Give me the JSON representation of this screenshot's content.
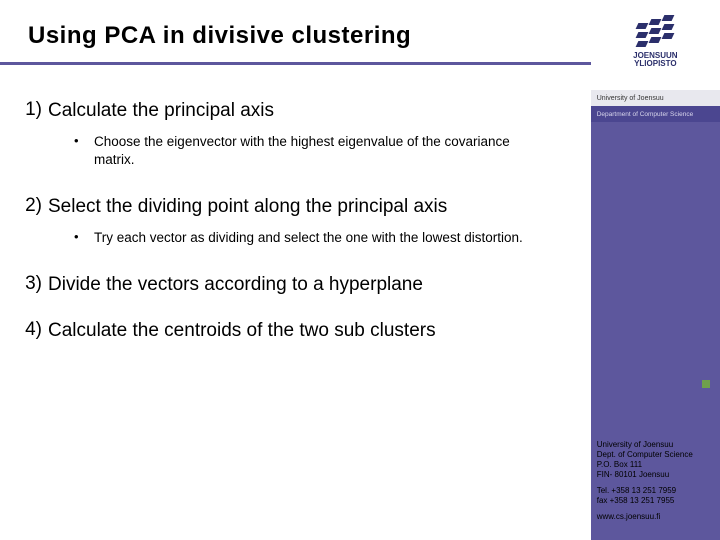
{
  "title": "Using PCA in divisive clustering",
  "items": [
    {
      "num": "1)",
      "text": "Calculate the principal axis",
      "sub": {
        "text": "Choose the eigenvector with the highest eigenvalue of the covariance matrix."
      }
    },
    {
      "num": "2)",
      "text": "Select the dividing point along the principal axis",
      "sub": {
        "text": "Try each vector as dividing and select the one with the lowest distortion."
      }
    },
    {
      "num": "3)",
      "text": "Divide the vectors according to a hyperplane"
    },
    {
      "num": "4)",
      "text": "Calculate the centroids of the two sub clusters"
    }
  ],
  "logo": {
    "line1": "JOENSUUN",
    "line2": "YLIOPISTO"
  },
  "band1": "University of Joensuu",
  "band2": "Department of Computer Science",
  "footer": {
    "org": "University of Joensuu",
    "dept": "Dept. of Computer Science",
    "pobox": "P.O. Box 111",
    "city": "FIN- 80101 Joensuu",
    "tel": "Tel. +358 13 251 7959",
    "fax": "fax +358 13 251 7955",
    "url": "www.cs.joensuu.fi"
  }
}
